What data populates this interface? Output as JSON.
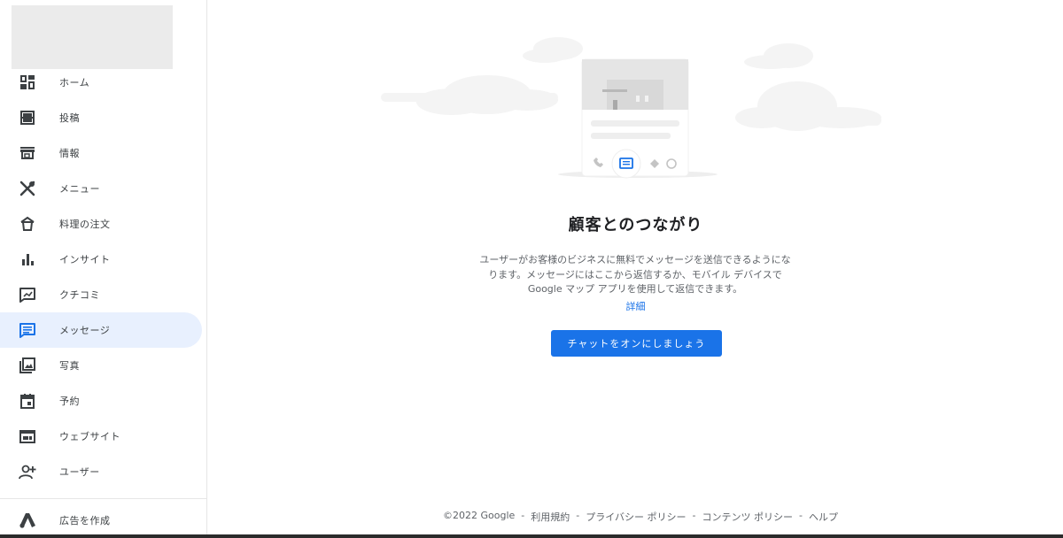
{
  "sidebar": {
    "items": [
      {
        "label": "ホーム",
        "icon": "dashboard-icon"
      },
      {
        "label": "投稿",
        "icon": "post-icon"
      },
      {
        "label": "情報",
        "icon": "storefront-icon"
      },
      {
        "label": "メニュー",
        "icon": "restaurant-icon"
      },
      {
        "label": "料理の注文",
        "icon": "takeout-icon"
      },
      {
        "label": "インサイト",
        "icon": "bar-chart-icon"
      },
      {
        "label": "クチコミ",
        "icon": "review-icon"
      },
      {
        "label": "メッセージ",
        "icon": "message-icon",
        "active": true
      },
      {
        "label": "写真",
        "icon": "photo-library-icon"
      },
      {
        "label": "予約",
        "icon": "calendar-icon"
      },
      {
        "label": "ウェブサイト",
        "icon": "website-icon"
      },
      {
        "label": "ユーザー",
        "icon": "add-user-icon"
      }
    ],
    "ads": {
      "label": "広告を作成",
      "icon": "google-ads-icon"
    }
  },
  "main": {
    "title": "顧客とのつながり",
    "description_lines": [
      "ユーザーがお客様のビジネスに無料でメッセージを送信できるようにな",
      "ります。メッセージにはここから返信するか、モバイル デバイスで",
      "Google マップ アプリを使用して返信できます。"
    ],
    "more_link": "詳細",
    "cta_label": "チャットをオンにしましょう"
  },
  "footer": {
    "items": [
      "©2022 Google",
      "-",
      "利用規約",
      "-",
      "プライバシー ポリシー",
      "-",
      "コンテンツ ポリシー",
      "-",
      "ヘルプ"
    ]
  },
  "colors": {
    "accent": "#1a73e8",
    "active_bg": "#e8f0fe"
  }
}
